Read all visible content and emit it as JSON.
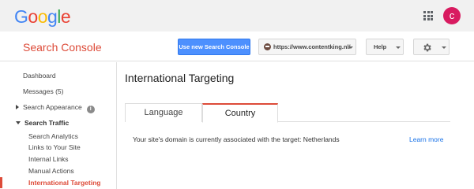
{
  "google_bar": {
    "logo_letters": [
      "G",
      "o",
      "o",
      "g",
      "l",
      "e"
    ],
    "avatar_letter": "c",
    "avatar_color": "#d81b60"
  },
  "header": {
    "title": "Search Console",
    "add_property_button": "Use new Search Console",
    "site_selector": "https://www.contentking.nl/",
    "help_button": "Help",
    "brand_color": "#dd4b39",
    "primary_button_color": "#4d90fe"
  },
  "sidebar": {
    "items": [
      {
        "label": "Dashboard"
      },
      {
        "label": "Messages (5)"
      },
      {
        "label": "Search Appearance",
        "info": "i"
      },
      {
        "label": "Search Traffic"
      }
    ],
    "sub_items": [
      {
        "label": "Search Analytics"
      },
      {
        "label": "Links to Your Site"
      },
      {
        "label": "Internal Links"
      },
      {
        "label": "Manual Actions"
      },
      {
        "label": "International Targeting",
        "active": true
      }
    ]
  },
  "main": {
    "page_title": "International Targeting",
    "tabs": [
      {
        "label": "Language",
        "selected": false
      },
      {
        "label": "Country",
        "selected": true
      }
    ],
    "message": "Your site's domain is currently associated with the target: Netherlands",
    "learn_more": "Learn more"
  },
  "icons": [
    "apps-grid-icon",
    "caret-down-icon",
    "gear-icon",
    "info-icon",
    "site-favicon-icon"
  ]
}
